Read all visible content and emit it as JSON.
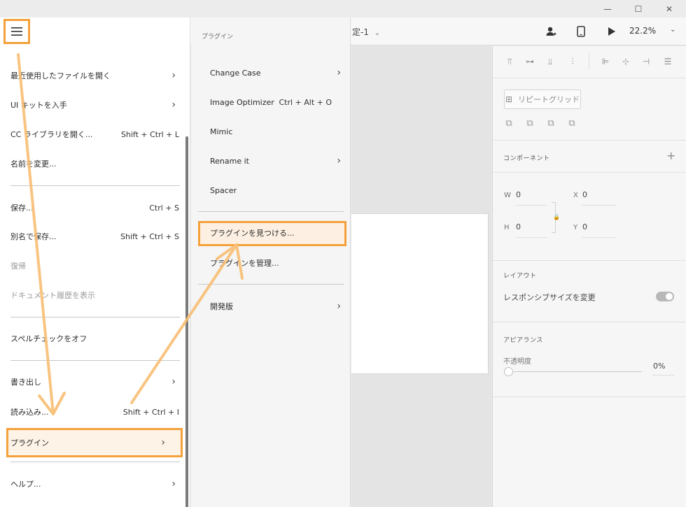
{
  "window": {
    "minimize": "—",
    "maximize": "☐",
    "close": "✕"
  },
  "toolbar": {
    "doc_title": "定-1",
    "zoom": "22.2%",
    "icons": [
      "share-user-icon",
      "device-preview-icon",
      "play-icon"
    ]
  },
  "menu": {
    "items": [
      {
        "label": "最近使用したファイルを開く",
        "submenu": true
      },
      {
        "label": "UI キットを入手",
        "submenu": true
      },
      {
        "label": "CC ライブラリを開く...",
        "shortcut": "Shift + Ctrl + L"
      },
      {
        "label": "名前を変更..."
      },
      {
        "label": "保存...",
        "shortcut": "Ctrl + S"
      },
      {
        "label": "別名で保存...",
        "shortcut": "Shift + Ctrl + S"
      },
      {
        "label": "復帰",
        "disabled": true
      },
      {
        "label": "ドキュメント履歴を表示",
        "disabled": true
      },
      {
        "label": "スペルチェックをオフ"
      },
      {
        "label": "書き出し",
        "submenu": true
      },
      {
        "label": "読み込み...",
        "shortcut": "Shift + Ctrl + I"
      },
      {
        "label": "プラグイン",
        "submenu": true,
        "highlighted": true
      },
      {
        "label": "ヘルプ...",
        "submenu": true
      }
    ]
  },
  "submenu": {
    "header": "プラグイン",
    "items": [
      {
        "label": "Change Case",
        "submenu": true
      },
      {
        "label": "Image Optimizer",
        "shortcut": "Ctrl + Alt + O"
      },
      {
        "label": "Mimic"
      },
      {
        "label": "Rename it",
        "submenu": true
      },
      {
        "label": "Spacer"
      },
      {
        "label": "プラグインを見つける...",
        "highlighted": true
      },
      {
        "label": "プラグインを管理..."
      },
      {
        "label": "開発版",
        "submenu": true
      }
    ]
  },
  "panel": {
    "repeat_grid": "リピートグリッド",
    "component_title": "コンポーネント",
    "w_label": "W",
    "w_value": "0",
    "x_label": "X",
    "x_value": "0",
    "h_label": "H",
    "h_value": "0",
    "y_label": "Y",
    "y_value": "0",
    "layout_title": "レイアウト",
    "responsive_label": "レスポンシブサイズを変更",
    "appearance_title": "アピアランス",
    "opacity_label": "不透明度",
    "opacity_value": "0%"
  },
  "colors": {
    "highlight": "#f4a13b",
    "arrow": "#f8be73"
  }
}
